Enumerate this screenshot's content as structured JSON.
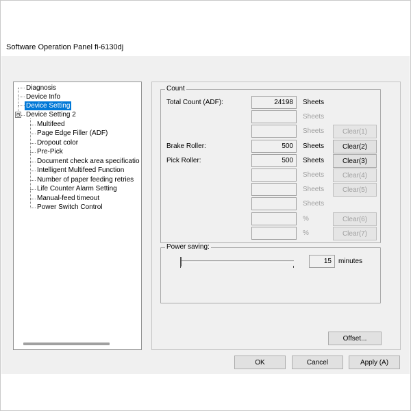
{
  "window": {
    "title": "Software Operation Panel fi-6130dj"
  },
  "tree": {
    "items": [
      {
        "label": "Diagnosis"
      },
      {
        "label": "Device Info"
      },
      {
        "label": "Device Setting"
      },
      {
        "label": "Device Setting 2",
        "expander": "⊟"
      },
      {
        "label": "Multifeed"
      },
      {
        "label": "Page Edge Filler (ADF)"
      },
      {
        "label": "Dropout color"
      },
      {
        "label": "Pre-Pick"
      },
      {
        "label": "Document check area specificatio"
      },
      {
        "label": "Intelligent Multifeed Function"
      },
      {
        "label": "Number of paper feeding retries"
      },
      {
        "label": "Life Counter Alarm Setting"
      },
      {
        "label": "Manual-feed timeout"
      },
      {
        "label": "Power Switch Control"
      }
    ],
    "selected_index": 2
  },
  "count": {
    "legend": "Count",
    "rows": [
      {
        "label": "Total Count (ADF):",
        "value": "24198",
        "unit": "Sheets",
        "unit_enabled": true,
        "button": ""
      },
      {
        "label": "",
        "value": "",
        "unit": "Sheets",
        "unit_enabled": false,
        "button": ""
      },
      {
        "label": "",
        "value": "",
        "unit": "Sheets",
        "unit_enabled": false,
        "button": "Clear(1)",
        "button_enabled": false
      },
      {
        "label": "Brake Roller:",
        "value": "500",
        "unit": "Sheets",
        "unit_enabled": true,
        "button": "Clear(2)",
        "button_enabled": true
      },
      {
        "label": "Pick Roller:",
        "value": "500",
        "unit": "Sheets",
        "unit_enabled": true,
        "button": "Clear(3)",
        "button_enabled": true
      },
      {
        "label": "",
        "value": "",
        "unit": "Sheets",
        "unit_enabled": false,
        "button": "Clear(4)",
        "button_enabled": false
      },
      {
        "label": "",
        "value": "",
        "unit": "Sheets",
        "unit_enabled": false,
        "button": "Clear(5)",
        "button_enabled": false
      },
      {
        "label": "",
        "value": "",
        "unit": "Sheets",
        "unit_enabled": false,
        "button": ""
      },
      {
        "label": "",
        "value": "",
        "unit": "%",
        "unit_enabled": false,
        "button": "Clear(6)",
        "button_enabled": false
      },
      {
        "label": "",
        "value": "",
        "unit": "%",
        "unit_enabled": false,
        "button": "Clear(7)",
        "button_enabled": false
      }
    ]
  },
  "power_saving": {
    "legend": "Power saving:",
    "value": "15",
    "unit": "minutes",
    "slider_fraction": 0.0
  },
  "buttons": {
    "offset": "Offset...",
    "ok": "OK",
    "cancel": "Cancel",
    "apply": "Apply (A)"
  },
  "colors": {
    "selection": "#0078d7",
    "window_bg": "#f0f0f0",
    "disabled_text": "#a0a0a0"
  }
}
